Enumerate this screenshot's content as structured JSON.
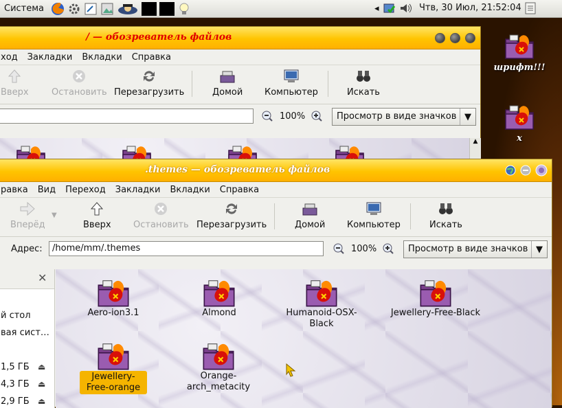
{
  "panel": {
    "system_menu": "Система",
    "clock": "Чтв, 30 Июл, 21:52:04"
  },
  "desktop": {
    "icons": [
      {
        "label": "шрифт!!!"
      },
      {
        "label": "x"
      }
    ]
  },
  "back_window": {
    "title": "/ — обозреватель файлов",
    "menu": [
      "ход",
      "Закладки",
      "Вкладки",
      "Справка"
    ],
    "toolbar": {
      "up": "Вверх",
      "stop": "Остановить",
      "reload": "Перезагрузить",
      "home": "Домой",
      "computer": "Компьютер",
      "search": "Искать"
    },
    "zoom": "100%",
    "view_mode": "Просмотр в виде значков"
  },
  "front_window": {
    "title": ".themes — обозреватель файлов",
    "menu": [
      "равка",
      "Вид",
      "Переход",
      "Закладки",
      "Вкладки",
      "Справка"
    ],
    "toolbar": {
      "forward": "Вперёд",
      "up": "Вверх",
      "stop": "Остановить",
      "reload": "Перезагрузить",
      "home": "Домой",
      "computer": "Компьютер",
      "search": "Искать"
    },
    "location": {
      "label": "Адрес:",
      "value": "/home/mm/.themes"
    },
    "zoom": "100%",
    "view_mode": "Просмотр в виде значков",
    "sidebar": [
      {
        "label": "й стол"
      },
      {
        "label": "вая сист…"
      },
      {
        "label": "1,5 ГБ"
      },
      {
        "label": "4,3 ГБ"
      },
      {
        "label": "2,9 ГБ"
      }
    ],
    "files": [
      {
        "name": "Aero-ion3.1"
      },
      {
        "name": "Almond"
      },
      {
        "name": "Humanoid-OSX-Black"
      },
      {
        "name": "Jewellery-Free-Black"
      },
      {
        "name": "Jewellery-Free-orange",
        "selected": true
      },
      {
        "name": "Orange-arch_metacity"
      }
    ]
  }
}
